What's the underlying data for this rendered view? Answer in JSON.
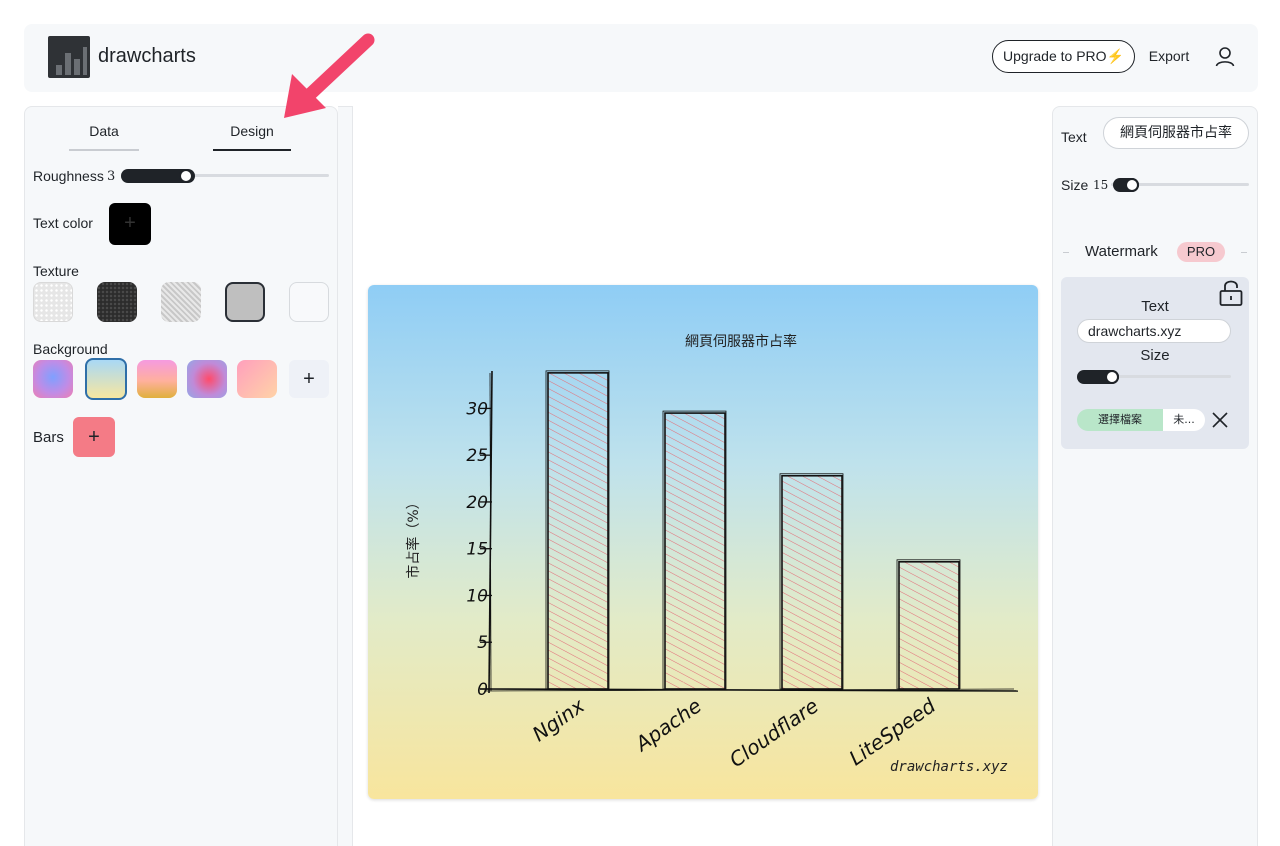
{
  "header": {
    "brand": "drawcharts",
    "upgrade_label": "Upgrade to PRO",
    "upgrade_icon": "⚡",
    "export_label": "Export",
    "user_icon": "user-icon"
  },
  "left_panel": {
    "tabs": [
      {
        "label": "Data",
        "active": false
      },
      {
        "label": "Design",
        "active": true
      }
    ],
    "roughness": {
      "label": "Roughness",
      "value": "3",
      "level": 0.3
    },
    "text_color": {
      "label": "Text color",
      "color": "#000000"
    },
    "texture": {
      "label": "Texture",
      "selected_index": 3
    },
    "background": {
      "label": "Background",
      "selected_index": 1
    },
    "bars": {
      "label": "Bars",
      "color": "#f47b86"
    }
  },
  "right_panel": {
    "text_label": "Text",
    "text_value": "網頁伺服器市占率",
    "size_label": "Size",
    "size_value": "15",
    "size_level": 0.0,
    "watermark": {
      "title": "Watermark",
      "badge": "PRO",
      "text_label": "Text",
      "text_value": "drawcharts.xyz",
      "size_label": "Size",
      "size_level": 0.2,
      "file_button": "選擇檔案",
      "file_name": "未..."
    }
  },
  "annotation": {
    "arrow_color": "#f2446b"
  },
  "chart_data": {
    "type": "bar",
    "title": "網頁伺服器市占率",
    "ylabel": "市占率（%）",
    "xlabel": "",
    "categories": [
      "Nginx",
      "Apache",
      "Cloudflare",
      "LiteSpeed"
    ],
    "values": [
      33.8,
      29.5,
      22.8,
      13.6
    ],
    "ylim": [
      0,
      34
    ],
    "yticks": [
      0,
      5,
      10,
      15,
      20,
      25,
      30
    ],
    "bar_color": "#f47b86",
    "watermark": "drawcharts.xyz",
    "grid": false,
    "legend": "none"
  }
}
